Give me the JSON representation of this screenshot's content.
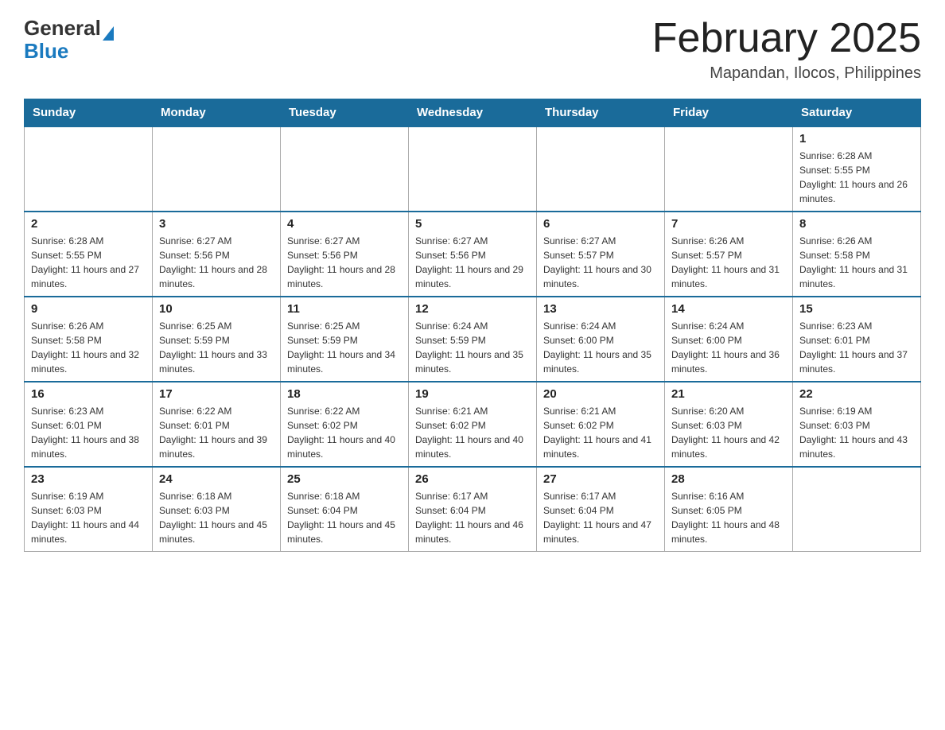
{
  "header": {
    "logo_general": "General",
    "logo_blue": "Blue",
    "month_title": "February 2025",
    "location": "Mapandan, Ilocos, Philippines"
  },
  "days_of_week": [
    "Sunday",
    "Monday",
    "Tuesday",
    "Wednesday",
    "Thursday",
    "Friday",
    "Saturday"
  ],
  "weeks": [
    [
      {
        "day": "",
        "sunrise": "",
        "sunset": "",
        "daylight": ""
      },
      {
        "day": "",
        "sunrise": "",
        "sunset": "",
        "daylight": ""
      },
      {
        "day": "",
        "sunrise": "",
        "sunset": "",
        "daylight": ""
      },
      {
        "day": "",
        "sunrise": "",
        "sunset": "",
        "daylight": ""
      },
      {
        "day": "",
        "sunrise": "",
        "sunset": "",
        "daylight": ""
      },
      {
        "day": "",
        "sunrise": "",
        "sunset": "",
        "daylight": ""
      },
      {
        "day": "1",
        "sunrise": "Sunrise: 6:28 AM",
        "sunset": "Sunset: 5:55 PM",
        "daylight": "Daylight: 11 hours and 26 minutes."
      }
    ],
    [
      {
        "day": "2",
        "sunrise": "Sunrise: 6:28 AM",
        "sunset": "Sunset: 5:55 PM",
        "daylight": "Daylight: 11 hours and 27 minutes."
      },
      {
        "day": "3",
        "sunrise": "Sunrise: 6:27 AM",
        "sunset": "Sunset: 5:56 PM",
        "daylight": "Daylight: 11 hours and 28 minutes."
      },
      {
        "day": "4",
        "sunrise": "Sunrise: 6:27 AM",
        "sunset": "Sunset: 5:56 PM",
        "daylight": "Daylight: 11 hours and 28 minutes."
      },
      {
        "day": "5",
        "sunrise": "Sunrise: 6:27 AM",
        "sunset": "Sunset: 5:56 PM",
        "daylight": "Daylight: 11 hours and 29 minutes."
      },
      {
        "day": "6",
        "sunrise": "Sunrise: 6:27 AM",
        "sunset": "Sunset: 5:57 PM",
        "daylight": "Daylight: 11 hours and 30 minutes."
      },
      {
        "day": "7",
        "sunrise": "Sunrise: 6:26 AM",
        "sunset": "Sunset: 5:57 PM",
        "daylight": "Daylight: 11 hours and 31 minutes."
      },
      {
        "day": "8",
        "sunrise": "Sunrise: 6:26 AM",
        "sunset": "Sunset: 5:58 PM",
        "daylight": "Daylight: 11 hours and 31 minutes."
      }
    ],
    [
      {
        "day": "9",
        "sunrise": "Sunrise: 6:26 AM",
        "sunset": "Sunset: 5:58 PM",
        "daylight": "Daylight: 11 hours and 32 minutes."
      },
      {
        "day": "10",
        "sunrise": "Sunrise: 6:25 AM",
        "sunset": "Sunset: 5:59 PM",
        "daylight": "Daylight: 11 hours and 33 minutes."
      },
      {
        "day": "11",
        "sunrise": "Sunrise: 6:25 AM",
        "sunset": "Sunset: 5:59 PM",
        "daylight": "Daylight: 11 hours and 34 minutes."
      },
      {
        "day": "12",
        "sunrise": "Sunrise: 6:24 AM",
        "sunset": "Sunset: 5:59 PM",
        "daylight": "Daylight: 11 hours and 35 minutes."
      },
      {
        "day": "13",
        "sunrise": "Sunrise: 6:24 AM",
        "sunset": "Sunset: 6:00 PM",
        "daylight": "Daylight: 11 hours and 35 minutes."
      },
      {
        "day": "14",
        "sunrise": "Sunrise: 6:24 AM",
        "sunset": "Sunset: 6:00 PM",
        "daylight": "Daylight: 11 hours and 36 minutes."
      },
      {
        "day": "15",
        "sunrise": "Sunrise: 6:23 AM",
        "sunset": "Sunset: 6:01 PM",
        "daylight": "Daylight: 11 hours and 37 minutes."
      }
    ],
    [
      {
        "day": "16",
        "sunrise": "Sunrise: 6:23 AM",
        "sunset": "Sunset: 6:01 PM",
        "daylight": "Daylight: 11 hours and 38 minutes."
      },
      {
        "day": "17",
        "sunrise": "Sunrise: 6:22 AM",
        "sunset": "Sunset: 6:01 PM",
        "daylight": "Daylight: 11 hours and 39 minutes."
      },
      {
        "day": "18",
        "sunrise": "Sunrise: 6:22 AM",
        "sunset": "Sunset: 6:02 PM",
        "daylight": "Daylight: 11 hours and 40 minutes."
      },
      {
        "day": "19",
        "sunrise": "Sunrise: 6:21 AM",
        "sunset": "Sunset: 6:02 PM",
        "daylight": "Daylight: 11 hours and 40 minutes."
      },
      {
        "day": "20",
        "sunrise": "Sunrise: 6:21 AM",
        "sunset": "Sunset: 6:02 PM",
        "daylight": "Daylight: 11 hours and 41 minutes."
      },
      {
        "day": "21",
        "sunrise": "Sunrise: 6:20 AM",
        "sunset": "Sunset: 6:03 PM",
        "daylight": "Daylight: 11 hours and 42 minutes."
      },
      {
        "day": "22",
        "sunrise": "Sunrise: 6:19 AM",
        "sunset": "Sunset: 6:03 PM",
        "daylight": "Daylight: 11 hours and 43 minutes."
      }
    ],
    [
      {
        "day": "23",
        "sunrise": "Sunrise: 6:19 AM",
        "sunset": "Sunset: 6:03 PM",
        "daylight": "Daylight: 11 hours and 44 minutes."
      },
      {
        "day": "24",
        "sunrise": "Sunrise: 6:18 AM",
        "sunset": "Sunset: 6:03 PM",
        "daylight": "Daylight: 11 hours and 45 minutes."
      },
      {
        "day": "25",
        "sunrise": "Sunrise: 6:18 AM",
        "sunset": "Sunset: 6:04 PM",
        "daylight": "Daylight: 11 hours and 45 minutes."
      },
      {
        "day": "26",
        "sunrise": "Sunrise: 6:17 AM",
        "sunset": "Sunset: 6:04 PM",
        "daylight": "Daylight: 11 hours and 46 minutes."
      },
      {
        "day": "27",
        "sunrise": "Sunrise: 6:17 AM",
        "sunset": "Sunset: 6:04 PM",
        "daylight": "Daylight: 11 hours and 47 minutes."
      },
      {
        "day": "28",
        "sunrise": "Sunrise: 6:16 AM",
        "sunset": "Sunset: 6:05 PM",
        "daylight": "Daylight: 11 hours and 48 minutes."
      },
      {
        "day": "",
        "sunrise": "",
        "sunset": "",
        "daylight": ""
      }
    ]
  ]
}
